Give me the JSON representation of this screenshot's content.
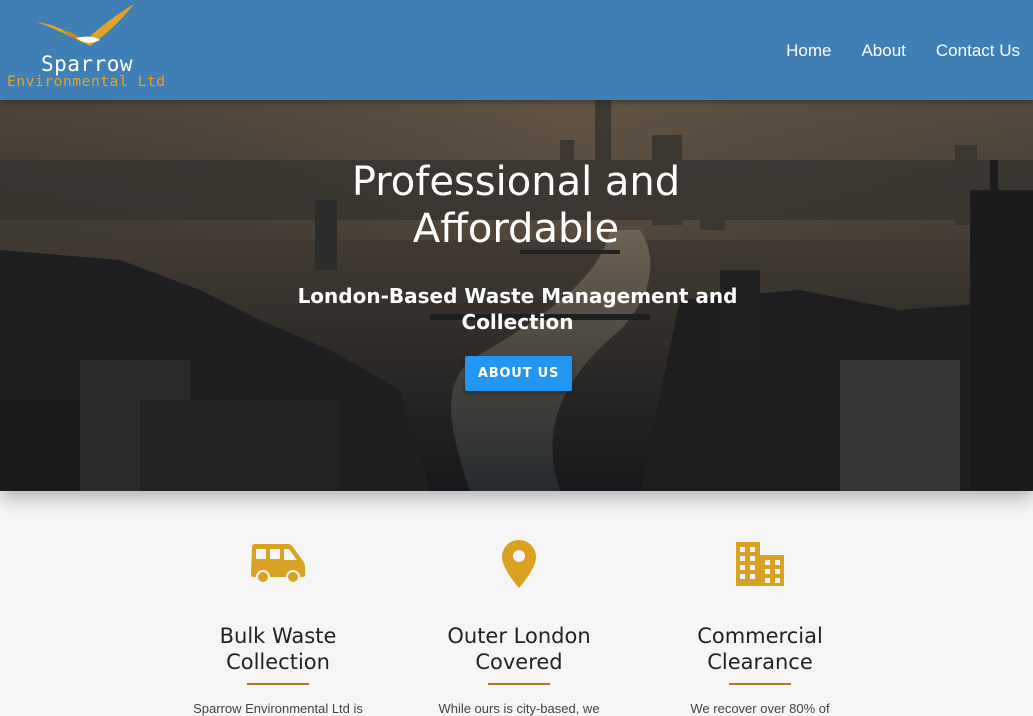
{
  "brand": {
    "name": "Sparrow",
    "subtitle": "Environmental Ltd",
    "icon": "sparrow-bird-logo",
    "colors": {
      "accent": "#e3a22b",
      "nav": "#3f7fb6"
    }
  },
  "nav": {
    "items": [
      {
        "label": "Home"
      },
      {
        "label": "About"
      },
      {
        "label": "Contact Us"
      }
    ]
  },
  "hero": {
    "title": "Professional and Affordable",
    "subtitle": "London-Based Waste Management and Collection",
    "button_label": "ABOUT US",
    "background": "london-skyline-aerial-photo",
    "button_color": "#2196f3"
  },
  "features": [
    {
      "icon": "van-icon",
      "title_line1": "Bulk Waste",
      "title_line2": "Collection",
      "text": "Sparrow Environmental Ltd is"
    },
    {
      "icon": "map-pin-icon",
      "title_line1": "Outer London",
      "title_line2": "Covered",
      "text": "While ours is city-based, we"
    },
    {
      "icon": "building-icon",
      "title_line1": "Commercial",
      "title_line2": "Clearance",
      "text": "We recover over 80% of"
    }
  ],
  "feature_icon_color": "#d9a223"
}
